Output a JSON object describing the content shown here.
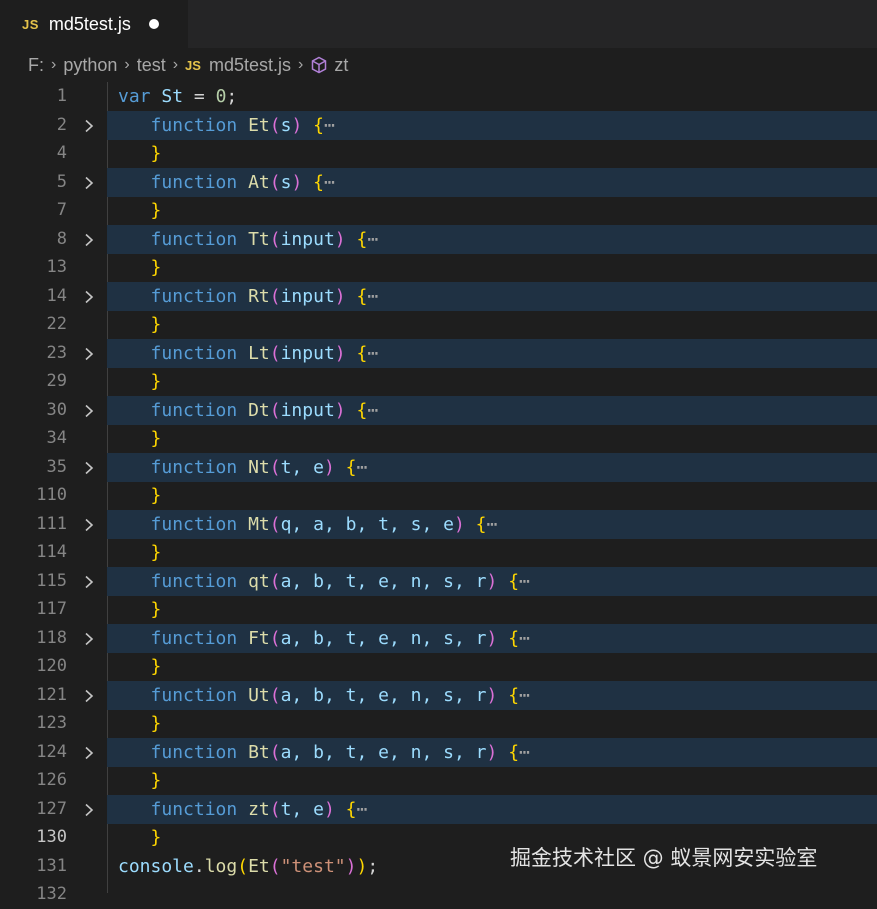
{
  "tab": {
    "badge": "JS",
    "title": "md5test.js"
  },
  "breadcrumb": {
    "drive": "F:",
    "folder1": "python",
    "folder2": "test",
    "js_badge": "JS",
    "file": "md5test.js",
    "symbol": "zt"
  },
  "editor": {
    "first_line": {
      "number": "1",
      "keyword": "var",
      "name": "St",
      "op": " = ",
      "value": "0",
      "end": ";"
    },
    "folded": [
      {
        "line": "2",
        "end_line": "4",
        "keyword": "function",
        "name": "Et",
        "params": "s"
      },
      {
        "line": "5",
        "end_line": "7",
        "keyword": "function",
        "name": "At",
        "params": "s"
      },
      {
        "line": "8",
        "end_line": "13",
        "keyword": "function",
        "name": "Tt",
        "params": "input"
      },
      {
        "line": "14",
        "end_line": "22",
        "keyword": "function",
        "name": "Rt",
        "params": "input"
      },
      {
        "line": "23",
        "end_line": "29",
        "keyword": "function",
        "name": "Lt",
        "params": "input"
      },
      {
        "line": "30",
        "end_line": "34",
        "keyword": "function",
        "name": "Dt",
        "params": "input"
      },
      {
        "line": "35",
        "end_line": "110",
        "keyword": "function",
        "name": "Nt",
        "params": "t, e"
      },
      {
        "line": "111",
        "end_line": "114",
        "keyword": "function",
        "name": "Mt",
        "params": "q, a, b, t, s, e"
      },
      {
        "line": "115",
        "end_line": "117",
        "keyword": "function",
        "name": "qt",
        "params": "a, b, t, e, n, s, r"
      },
      {
        "line": "118",
        "end_line": "120",
        "keyword": "function",
        "name": "Ft",
        "params": "a, b, t, e, n, s, r"
      },
      {
        "line": "121",
        "end_line": "123",
        "keyword": "function",
        "name": "Ut",
        "params": "a, b, t, e, n, s, r"
      },
      {
        "line": "124",
        "end_line": "126",
        "keyword": "function",
        "name": "Bt",
        "params": "a, b, t, e, n, s, r"
      },
      {
        "line": "127",
        "end_line": "130",
        "keyword": "function",
        "name": "zt",
        "params": "t, e"
      }
    ],
    "last_line": {
      "number": "131",
      "object": "console",
      "method": "log",
      "call": "Et",
      "arg": "\"test\"",
      "end": ";"
    },
    "fold_ellipsis": "⋯",
    "cut_line": "132"
  },
  "watermark": "掘金技术社区 @ 蚁景网安实验室",
  "colors": {
    "keyword": "#569cd6",
    "function_name": "#dcdcaa",
    "param": "#9cdcfe",
    "brace": "#ffd700",
    "string": "#ce9178",
    "number": "#b5cea8",
    "fold_highlight": "#1f3143"
  }
}
